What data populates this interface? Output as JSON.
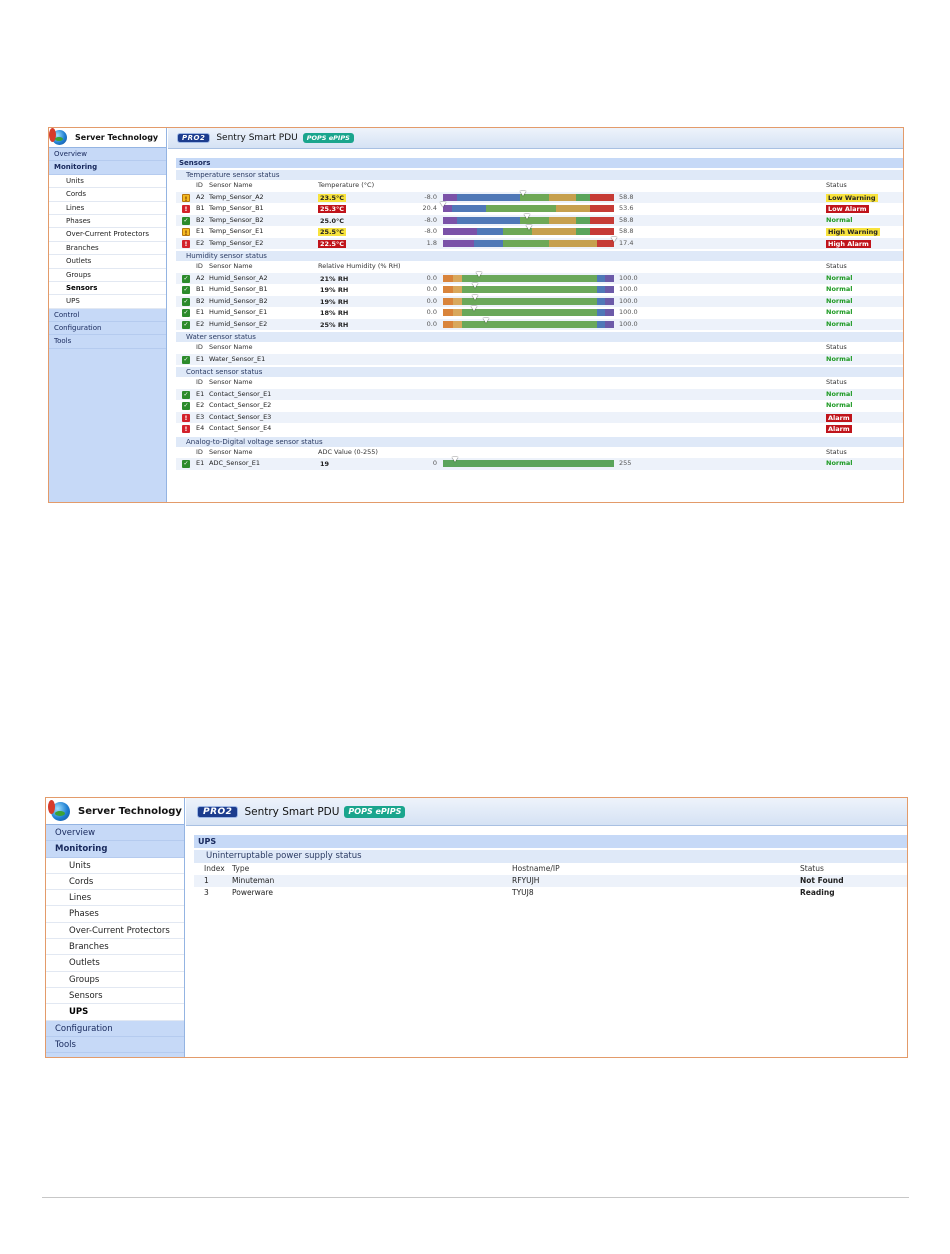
{
  "sidebar_sensors": {
    "brand": "Server Technology",
    "items": [
      {
        "label": "Overview",
        "level": "top"
      },
      {
        "label": "Monitoring",
        "level": "top",
        "bold": true
      },
      {
        "label": "Units",
        "level": "sub"
      },
      {
        "label": "Cords",
        "level": "sub"
      },
      {
        "label": "Lines",
        "level": "sub"
      },
      {
        "label": "Phases",
        "level": "sub"
      },
      {
        "label": "Over-Current Protectors",
        "level": "sub"
      },
      {
        "label": "Branches",
        "level": "sub"
      },
      {
        "label": "Outlets",
        "level": "sub"
      },
      {
        "label": "Groups",
        "level": "sub"
      },
      {
        "label": "Sensors",
        "level": "sub",
        "active": true
      },
      {
        "label": "UPS",
        "level": "sub"
      },
      {
        "label": "Control",
        "level": "top"
      },
      {
        "label": "Configuration",
        "level": "top"
      },
      {
        "label": "Tools",
        "level": "top"
      }
    ]
  },
  "sidebar_ups": {
    "brand": "Server Technology",
    "items": [
      {
        "label": "Overview",
        "level": "top"
      },
      {
        "label": "Monitoring",
        "level": "top",
        "bold": true
      },
      {
        "label": "Units",
        "level": "sub"
      },
      {
        "label": "Cords",
        "level": "sub"
      },
      {
        "label": "Lines",
        "level": "sub"
      },
      {
        "label": "Phases",
        "level": "sub"
      },
      {
        "label": "Over-Current Protectors",
        "level": "sub"
      },
      {
        "label": "Branches",
        "level": "sub"
      },
      {
        "label": "Outlets",
        "level": "sub"
      },
      {
        "label": "Groups",
        "level": "sub"
      },
      {
        "label": "Sensors",
        "level": "sub"
      },
      {
        "label": "UPS",
        "level": "sub",
        "active": true
      },
      {
        "label": "Configuration",
        "level": "top"
      },
      {
        "label": "Tools",
        "level": "top"
      }
    ]
  },
  "banner": {
    "pro_badge": "PRO2",
    "title": "Sentry Smart PDU",
    "pops_badge": "POPS ePIPS"
  },
  "sensors": {
    "page_title": "Sensors",
    "headers": {
      "id": "ID",
      "name": "Sensor Name",
      "status": "Status"
    },
    "sections": [
      {
        "title": "Temperature sensor status",
        "value_header": "Temperature (°C)",
        "rows": [
          {
            "icon": "warn",
            "id": "A2",
            "name": "Temp_Sensor_A2",
            "value": "23.5°C",
            "chip": "y",
            "min": "-8.0",
            "max": "58.8",
            "marker": 0.47,
            "bar": "temp1",
            "status": "Low Warning",
            "status_style": "y"
          },
          {
            "icon": "alarm",
            "id": "B1",
            "name": "Temp_Sensor_B1",
            "value": "25.3°C",
            "chip": "r",
            "min": "20.4",
            "max": "53.6",
            "marker": 0.0,
            "bar": "temp2",
            "status": "Low Alarm",
            "status_style": "r"
          },
          {
            "icon": "ok",
            "id": "B2",
            "name": "Temp_Sensor_B2",
            "value": "25.0°C",
            "chip": "",
            "min": "-8.0",
            "max": "58.8",
            "marker": 0.49,
            "bar": "temp1",
            "status": "Normal",
            "status_style": "normal"
          },
          {
            "icon": "warn",
            "id": "E1",
            "name": "Temp_Sensor_E1",
            "value": "25.5°C",
            "chip": "y",
            "min": "-8.0",
            "max": "58.8",
            "marker": 0.5,
            "bar": "temp3",
            "status": "High Warning",
            "status_style": "y"
          },
          {
            "icon": "alarm",
            "id": "E2",
            "name": "Temp_Sensor_E2",
            "value": "22.5°C",
            "chip": "r",
            "min": "1.8",
            "max": "17.4",
            "marker": 1.0,
            "bar": "temp4",
            "status": "High Alarm",
            "status_style": "r"
          }
        ]
      },
      {
        "title": "Humidity sensor status",
        "value_header": "Relative Humidity (% RH)",
        "rows": [
          {
            "icon": "ok",
            "id": "A2",
            "name": "Humid_Sensor_A2",
            "value": "21% RH",
            "chip": "",
            "min": "0.0",
            "max": "100.0",
            "marker": 0.21,
            "bar": "hum",
            "status": "Normal",
            "status_style": "normal"
          },
          {
            "icon": "ok",
            "id": "B1",
            "name": "Humid_Sensor_B1",
            "value": "19% RH",
            "chip": "",
            "min": "0.0",
            "max": "100.0",
            "marker": 0.19,
            "bar": "hum",
            "status": "Normal",
            "status_style": "normal"
          },
          {
            "icon": "ok",
            "id": "B2",
            "name": "Humid_Sensor_B2",
            "value": "19% RH",
            "chip": "",
            "min": "0.0",
            "max": "100.0",
            "marker": 0.19,
            "bar": "hum",
            "status": "Normal",
            "status_style": "normal"
          },
          {
            "icon": "ok",
            "id": "E1",
            "name": "Humid_Sensor_E1",
            "value": "18% RH",
            "chip": "",
            "min": "0.0",
            "max": "100.0",
            "marker": 0.18,
            "bar": "hum",
            "status": "Normal",
            "status_style": "normal"
          },
          {
            "icon": "ok",
            "id": "E2",
            "name": "Humid_Sensor_E2",
            "value": "25% RH",
            "chip": "",
            "min": "0.0",
            "max": "100.0",
            "marker": 0.25,
            "bar": "hum",
            "status": "Normal",
            "status_style": "normal"
          }
        ]
      },
      {
        "title": "Water sensor status",
        "value_header": "",
        "rows": [
          {
            "icon": "ok",
            "id": "E1",
            "name": "Water_Sensor_E1",
            "value": "",
            "chip": "",
            "min": "",
            "max": "",
            "bar": "",
            "status": "Normal",
            "status_style": "normal"
          }
        ]
      },
      {
        "title": "Contact sensor status",
        "value_header": "",
        "rows": [
          {
            "icon": "ok",
            "id": "E1",
            "name": "Contact_Sensor_E1",
            "value": "",
            "chip": "",
            "min": "",
            "max": "",
            "bar": "",
            "status": "Normal",
            "status_style": "normal"
          },
          {
            "icon": "ok",
            "id": "E2",
            "name": "Contact_Sensor_E2",
            "value": "",
            "chip": "",
            "min": "",
            "max": "",
            "bar": "",
            "status": "Normal",
            "status_style": "normal"
          },
          {
            "icon": "alarm",
            "id": "E3",
            "name": "Contact_Sensor_E3",
            "value": "",
            "chip": "",
            "min": "",
            "max": "",
            "bar": "",
            "status": "Alarm",
            "status_style": "r"
          },
          {
            "icon": "alarm",
            "id": "E4",
            "name": "Contact_Sensor_E4",
            "value": "",
            "chip": "",
            "min": "",
            "max": "",
            "bar": "",
            "status": "Alarm",
            "status_style": "r"
          }
        ]
      },
      {
        "title": "Analog-to-Digital voltage sensor status",
        "value_header": "ADC Value (0-255)",
        "rows": [
          {
            "icon": "ok",
            "id": "E1",
            "name": "ADC_Sensor_E1",
            "value": "19",
            "chip": "",
            "min": "0",
            "max": "255",
            "marker": 0.07,
            "bar": "adc",
            "status": "Normal",
            "status_style": "normal"
          }
        ]
      }
    ]
  },
  "ups": {
    "page_title": "UPS",
    "section_title": "Uninterruptable power supply status",
    "headers": {
      "index": "Index",
      "type": "Type",
      "host": "Hostname/IP",
      "status": "Status"
    },
    "rows": [
      {
        "index": "1",
        "type": "Minuteman",
        "host": "RFYUJH",
        "status": "Not Found"
      },
      {
        "index": "3",
        "type": "Powerware",
        "host": "TYUJ8",
        "status": "Reading"
      }
    ]
  },
  "colors": {
    "sidebar": "#c6d9f7",
    "frame": "#e39b6a",
    "normal": "#1d9a23",
    "alarm": "#c0141b",
    "warning": "#f8e33d"
  }
}
